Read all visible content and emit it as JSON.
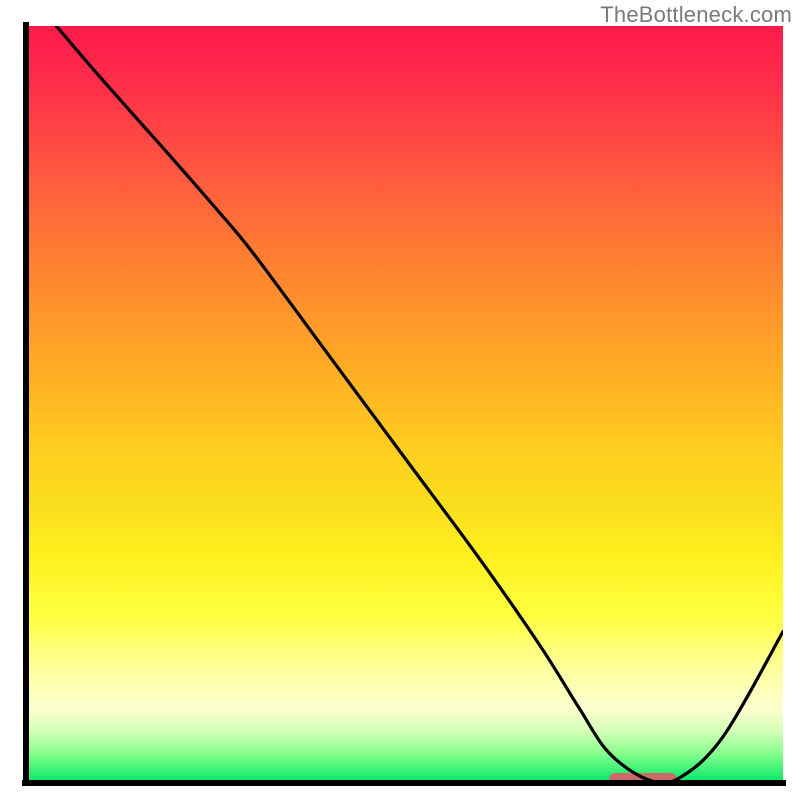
{
  "attribution": "TheBottleneck.com",
  "colors": {
    "curve": "#000000",
    "marker": "#cc6b6a",
    "axis": "#000000"
  },
  "chart_data": {
    "type": "line",
    "title": "",
    "xlabel": "",
    "ylabel": "",
    "xlim": [
      0,
      100
    ],
    "ylim": [
      0,
      100
    ],
    "series": [
      {
        "name": "bottleneck-curve",
        "x": [
          4,
          10,
          18,
          25,
          30,
          40,
          50,
          60,
          68,
          73,
          77,
          82,
          86,
          92,
          100
        ],
        "y": [
          100,
          93,
          84,
          76,
          70,
          56.5,
          43,
          29.5,
          18,
          10,
          4,
          0.5,
          0.5,
          6,
          20
        ]
      }
    ],
    "marker": {
      "x_start": 77,
      "x_end": 86,
      "y": 0.5
    },
    "gradient_stops": [
      {
        "pct": 0,
        "color": "#ff1a4b"
      },
      {
        "pct": 20,
        "color": "#ff5a3f"
      },
      {
        "pct": 44,
        "color": "#ffa826"
      },
      {
        "pct": 70,
        "color": "#fff01e"
      },
      {
        "pct": 90,
        "color": "#fdffce"
      },
      {
        "pct": 100,
        "color": "#00e765"
      }
    ]
  }
}
